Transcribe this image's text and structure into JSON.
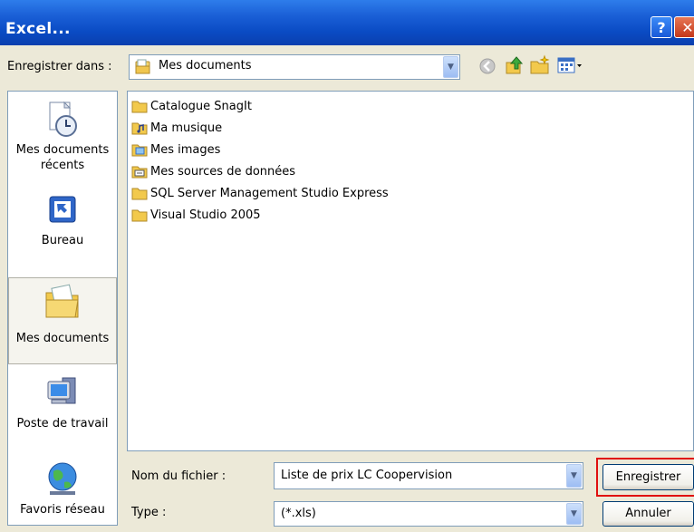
{
  "window": {
    "title": "Excel...",
    "help_label": "?",
    "close_label": "✕"
  },
  "save_in": {
    "label": "Enregistrer dans :",
    "value": "Mes documents"
  },
  "places": [
    {
      "label_line1": "Mes documents",
      "label_line2": "récents",
      "icon": "recent-documents-icon"
    },
    {
      "label_line1": "Bureau",
      "icon": "desktop-icon"
    },
    {
      "label_line1": "Mes documents",
      "icon": "my-documents-icon",
      "selected": true
    },
    {
      "label_line1": "Poste de travail",
      "icon": "my-computer-icon"
    },
    {
      "label_line1": "Favoris réseau",
      "icon": "network-places-icon"
    }
  ],
  "files": [
    {
      "name": "Catalogue SnagIt",
      "icon": "folder-icon"
    },
    {
      "name": "Ma musique",
      "icon": "music-folder-icon"
    },
    {
      "name": "Mes images",
      "icon": "pictures-folder-icon"
    },
    {
      "name": "Mes sources de données",
      "icon": "data-sources-folder-icon"
    },
    {
      "name": "SQL Server Management Studio Express",
      "icon": "folder-icon"
    },
    {
      "name": "Visual Studio 2005",
      "icon": "folder-icon"
    }
  ],
  "filename": {
    "label": "Nom du fichier :",
    "value": "Liste de prix LC Coopervision"
  },
  "filetype": {
    "label": "Type :",
    "value": "(*.xls)"
  },
  "buttons": {
    "save": "Enregistrer",
    "cancel": "Annuler"
  },
  "colors": {
    "titlebar": "#0A4BC4",
    "highlight": "#E01010",
    "dialog_bg": "#ECE9D8"
  }
}
